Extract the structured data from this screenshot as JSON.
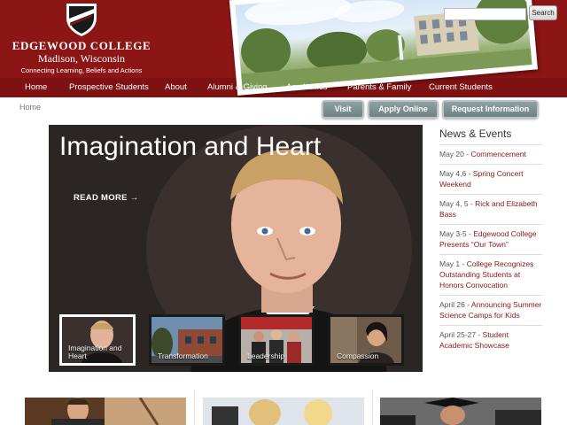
{
  "header": {
    "college_name": "EDGEWOOD COLLEGE",
    "city": "Madison, Wisconsin",
    "tagline": "Connecting Learning, Beliefs and Actions",
    "brand_color": "#8c1515",
    "crest_icon": "shield-crest-icon"
  },
  "search": {
    "placeholder": "",
    "button_label": "Search"
  },
  "nav": {
    "items": [
      {
        "label": "Home"
      },
      {
        "label": "Prospective Students"
      },
      {
        "label": "About"
      },
      {
        "label": "Alumni & Giving"
      },
      {
        "label": "Academics"
      },
      {
        "label": "Parents & Family"
      },
      {
        "label": "Current Students"
      }
    ]
  },
  "breadcrumb": {
    "label": "Home"
  },
  "actions": {
    "visit": "Visit",
    "apply": "Apply Online",
    "request": "Request Information"
  },
  "hero": {
    "title": "Imagination and Heart",
    "read_more": "READ MORE →",
    "thumbs": [
      {
        "label": "Imagination and Heart"
      },
      {
        "label": "Transformation"
      },
      {
        "label": "Leadership"
      },
      {
        "label": "Compassion"
      }
    ]
  },
  "news": {
    "heading": "News & Events",
    "items": [
      {
        "date": "May 20 - ",
        "title": "Commencement"
      },
      {
        "date": "May 4,6 - ",
        "title": "Spring Concert Weekend"
      },
      {
        "date": "May 4, 5 - ",
        "title": "Rick and Elizabeth Bass"
      },
      {
        "date": "May 3-5 - ",
        "title": "Edgewood College Presents “Our Town”"
      },
      {
        "date": "May 1 - ",
        "title": "College Recognizes Outstanding Students at Honors Convocation"
      },
      {
        "date": "April 26 - ",
        "title": "Announcing Summer Science Camps for Kids"
      },
      {
        "date": "April 25-27 - ",
        "title": "Student Academic Showcase"
      }
    ]
  }
}
